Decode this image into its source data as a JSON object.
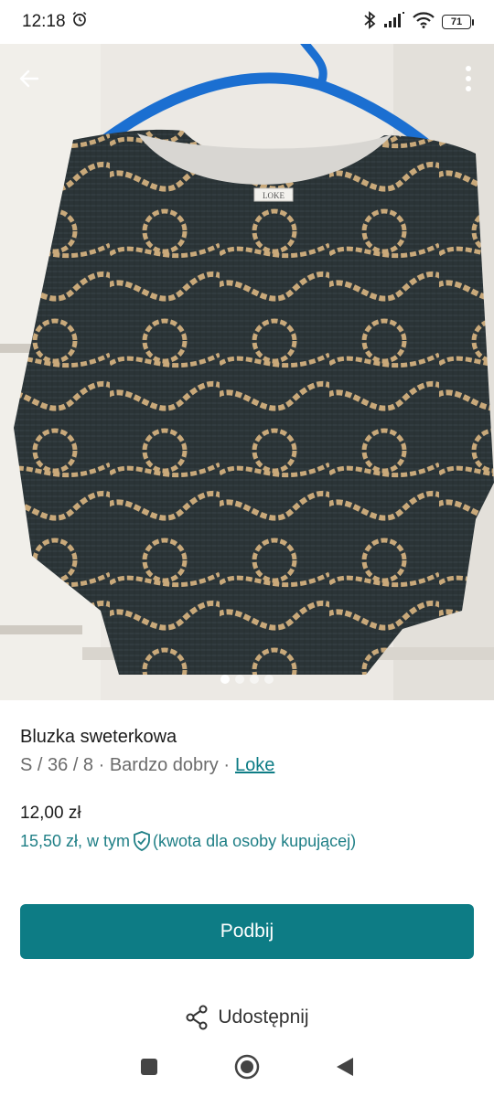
{
  "status_bar": {
    "time": "12:18",
    "battery": "71"
  },
  "hero": {
    "image_label": "LOKE",
    "pager": {
      "count": 4,
      "active_index": 0
    }
  },
  "product": {
    "title": "Bluzka sweterkowa",
    "meta_text": "S / 36 / 8 · Bardzo dobry ·",
    "brand": "Loke",
    "price": "12,00 zł",
    "price_total_prefix": "15,50 zł, w tym",
    "price_total_suffix": "(kwota dla osoby kupującej)"
  },
  "actions": {
    "primary_label": "Podbij",
    "share_label": "Udostępnij"
  },
  "colors": {
    "accent": "#0d7c85",
    "accent_text": "#1f7f86",
    "sweater": "#2b3437",
    "chain": "#c9a97a",
    "hanger": "#1b6fd1"
  },
  "icons": {
    "back": "arrow-left-icon",
    "more": "more-vertical-icon",
    "shield": "shield-check-icon",
    "share": "share-icon",
    "alarm": "alarm-icon",
    "bluetooth": "bluetooth-icon",
    "signal": "signal-icon",
    "wifi": "wifi-icon",
    "battery": "battery-icon",
    "nav_recent": "square-icon",
    "nav_home": "circle-icon",
    "nav_back": "triangle-back-icon"
  }
}
